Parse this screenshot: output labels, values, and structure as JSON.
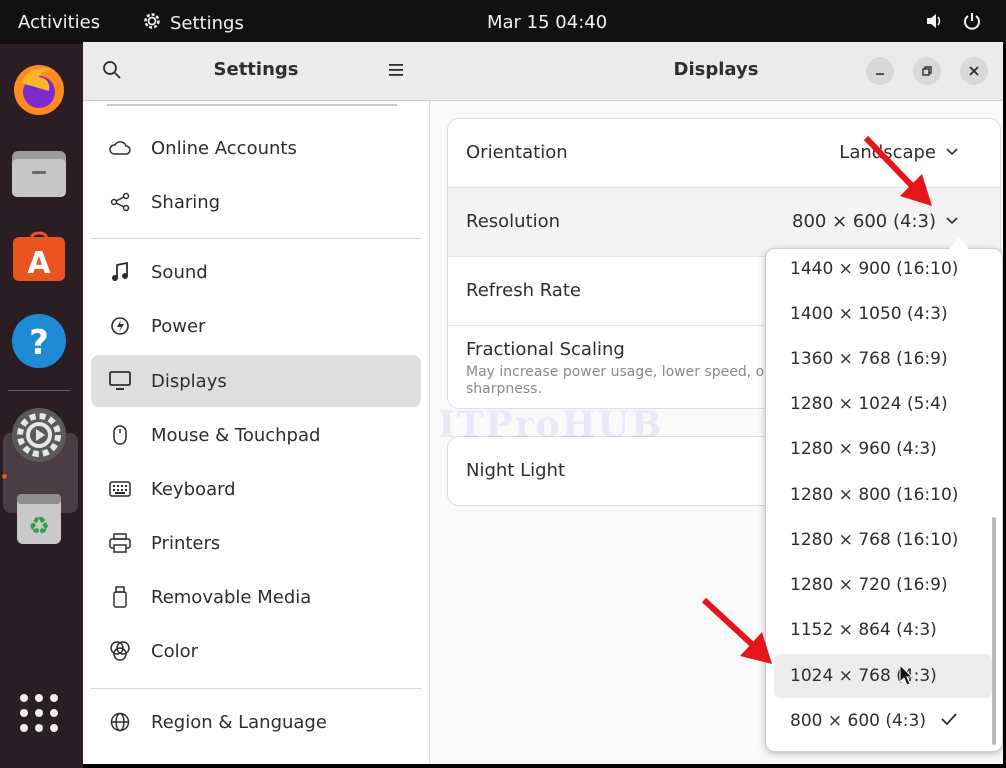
{
  "topbar": {
    "activities": "Activities",
    "app_name": "Settings",
    "clock": "Mar 15  04:40"
  },
  "dock": {
    "items": [
      "firefox-icon",
      "files-icon",
      "software-icon",
      "help-icon",
      "settings-icon",
      "trash-icon",
      "show-apps-icon"
    ]
  },
  "sidebar": {
    "title": "Settings",
    "items": [
      {
        "label": "Online Accounts",
        "icon": "cloud-icon"
      },
      {
        "label": "Sharing",
        "icon": "share-icon"
      },
      {
        "label": "Sound",
        "icon": "music-note-icon"
      },
      {
        "label": "Power",
        "icon": "power-icon"
      },
      {
        "label": "Displays",
        "icon": "monitor-icon",
        "selected": true
      },
      {
        "label": "Mouse & Touchpad",
        "icon": "mouse-icon"
      },
      {
        "label": "Keyboard",
        "icon": "keyboard-icon"
      },
      {
        "label": "Printers",
        "icon": "printer-icon"
      },
      {
        "label": "Removable Media",
        "icon": "usb-icon"
      },
      {
        "label": "Color",
        "icon": "color-icon"
      },
      {
        "label": "Region & Language",
        "icon": "globe-icon"
      }
    ]
  },
  "content": {
    "title": "Displays",
    "orientation": {
      "label": "Orientation",
      "value": "Landscape"
    },
    "resolution": {
      "label": "Resolution",
      "value": "800 × 600 (4:3)"
    },
    "refresh_rate": {
      "label": "Refresh Rate"
    },
    "fractional_scaling": {
      "label": "Fractional Scaling",
      "description_line1": "May increase power usage, lower speed, or",
      "description_line2": "sharpness."
    },
    "night_light": {
      "label": "Night Light"
    }
  },
  "resolution_popover": {
    "options": [
      "1440 × 900 (16:10)",
      "1400 × 1050 (4:3)",
      "1360 × 768 (16:9)",
      "1280 × 1024 (5:4)",
      "1280 × 960 (4:3)",
      "1280 × 800 (16:10)",
      "1280 × 768 (16:10)",
      "1280 × 720 (16:9)",
      "1152 × 864 (4:3)",
      "1024 × 768 (4:3)",
      "800 × 600 (4:3)"
    ],
    "hovered": "1024 × 768 (4:3)",
    "selected": "800 × 600 (4:3)"
  },
  "watermark": "ITProHUB",
  "colors": {
    "accent": "#e95420",
    "annotation_arrow": "#e8141b"
  }
}
